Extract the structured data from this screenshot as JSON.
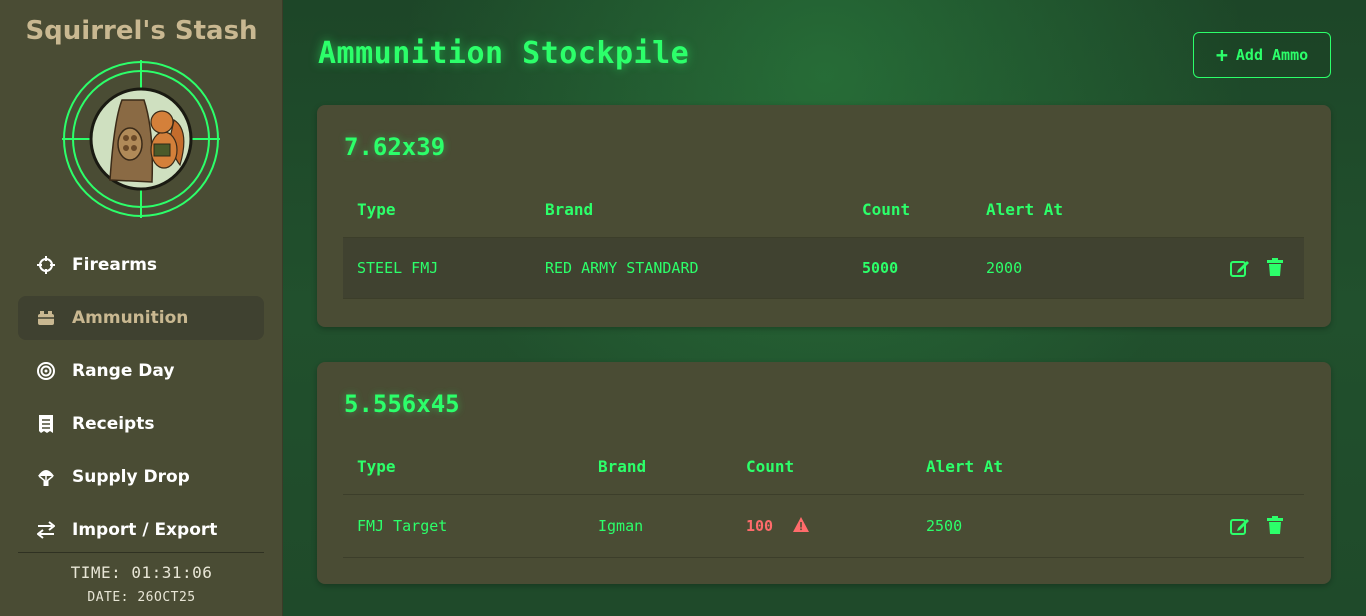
{
  "app": {
    "title": "Squirrel's Stash"
  },
  "sidebar": {
    "items": [
      {
        "label": "Firearms",
        "icon": "crosshairs-icon",
        "active": false
      },
      {
        "label": "Ammunition",
        "icon": "ammo-box-icon",
        "active": true
      },
      {
        "label": "Range Day",
        "icon": "target-icon",
        "active": false
      },
      {
        "label": "Receipts",
        "icon": "receipt-icon",
        "active": false
      },
      {
        "label": "Supply Drop",
        "icon": "parachute-icon",
        "active": false
      },
      {
        "label": "Import / Export",
        "icon": "exchange-icon",
        "active": false
      }
    ],
    "time": "TIME: 01:31:06",
    "date": "DATE: 26OCT25"
  },
  "main": {
    "title": "Ammunition Stockpile",
    "add_button": "Add Ammo",
    "sections": [
      {
        "caliber": "7.62x39",
        "headers": {
          "type": "Type",
          "brand": "Brand",
          "count": "Count",
          "alert": "Alert At"
        },
        "rows": [
          {
            "type": "STEEL FMJ",
            "brand": "RED ARMY STANDARD",
            "count": "5000",
            "alert": "2000",
            "low": false
          }
        ]
      },
      {
        "caliber": "5.556x45",
        "headers": {
          "type": "Type",
          "brand": "Brand",
          "count": "Count",
          "alert": "Alert At"
        },
        "rows": [
          {
            "type": "FMJ Target",
            "brand": "Igman",
            "count": "100",
            "alert": "2500",
            "low": true
          }
        ]
      }
    ]
  },
  "colors": {
    "accent": "#2cff6a",
    "sidebar_bg": "#4a4c34",
    "card_bg": "#4a4c34",
    "active_nav_text": "#c9b891",
    "warning": "#ff6b6b"
  }
}
